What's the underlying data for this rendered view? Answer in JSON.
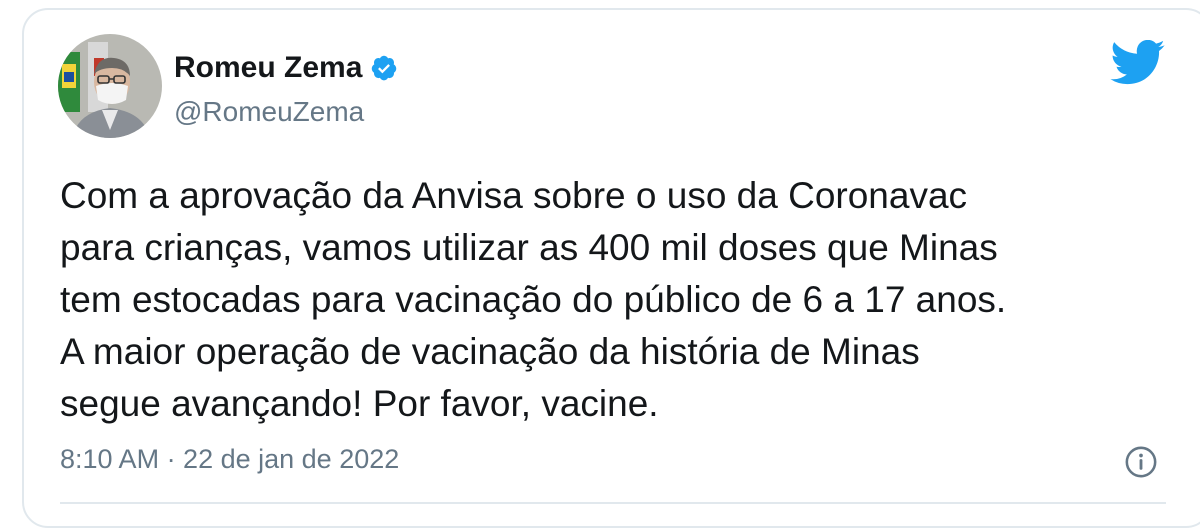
{
  "colors": {
    "twitter_blue": "#1DA1F2",
    "text_primary": "#14171a",
    "text_secondary": "#657786",
    "border": "#e1e8ed"
  },
  "author": {
    "name": "Romeu Zema",
    "handle": "@RomeuZema",
    "verified": true,
    "avatar_icon": "profile-photo",
    "verified_icon": "verified-badge-icon"
  },
  "brand_icon": "twitter-bird-icon",
  "tweet": {
    "lines": [
      "Com a aprovação da Anvisa sobre o uso da Coronavac",
      "para crianças, vamos utilizar as 400 mil doses que Minas",
      "tem estocadas para vacinação do público de 6 a 17 anos.",
      "A maior operação de vacinação da história de Minas",
      "segue avançando! Por favor, vacine."
    ],
    "timestamp": "8:10 AM · 22 de jan de 2022"
  },
  "info_icon": "info-icon"
}
